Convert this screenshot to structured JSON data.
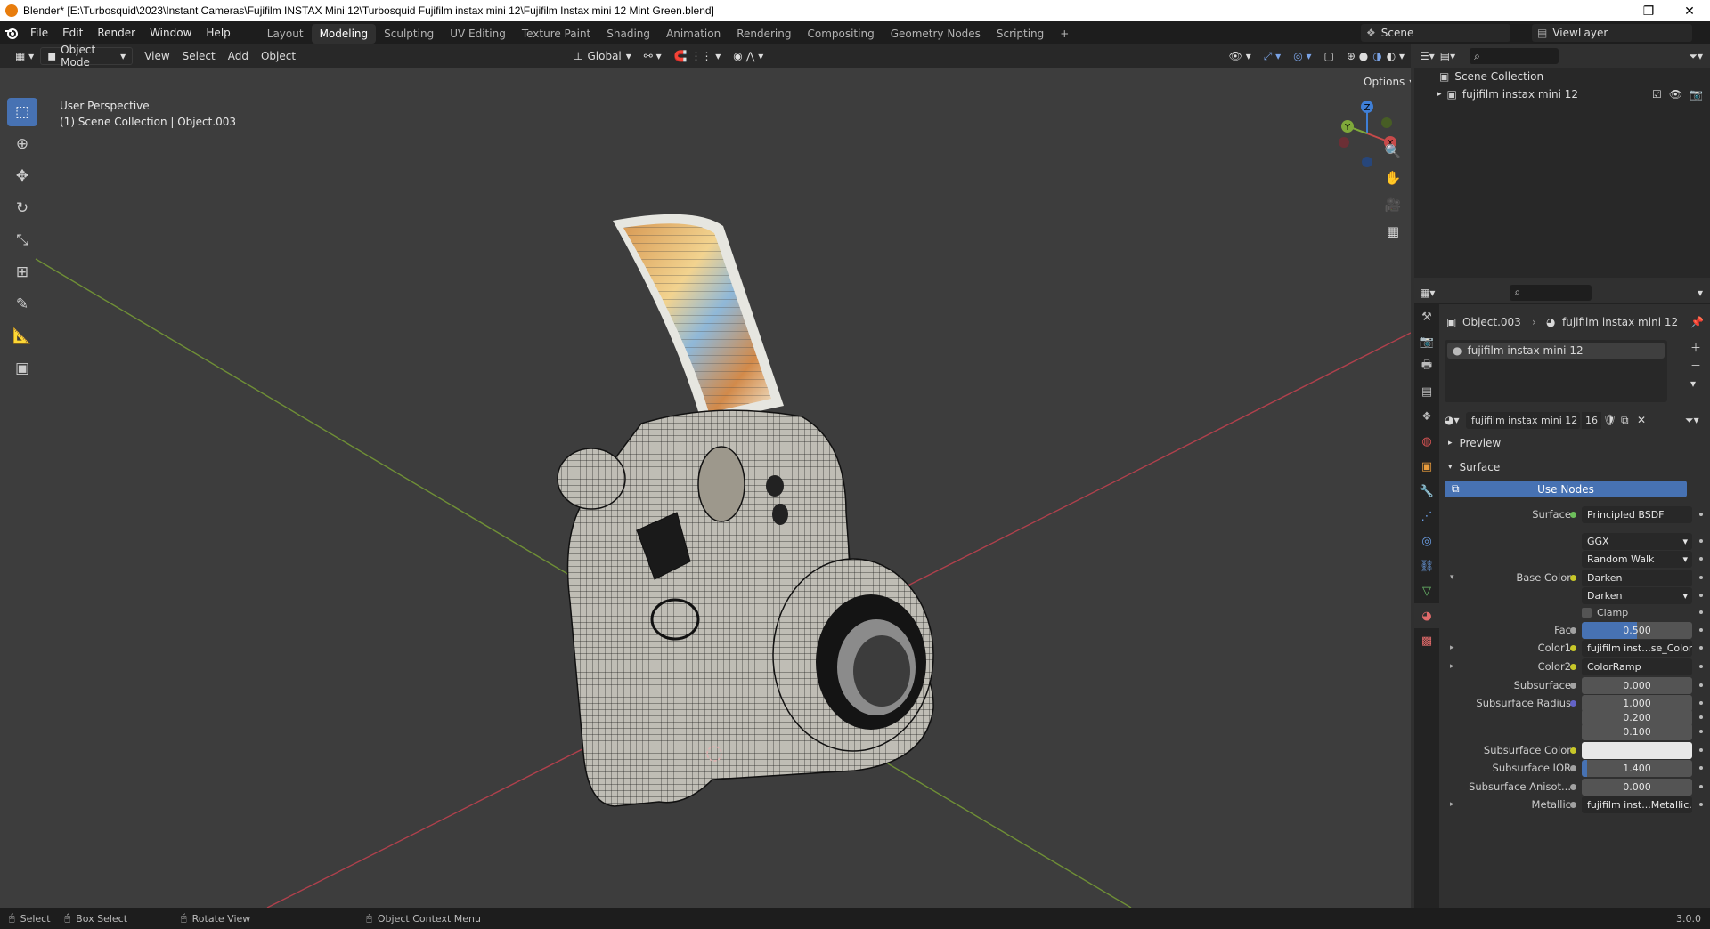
{
  "window": {
    "title": "Blender* [E:\\Turbosquid\\2023\\Instant Cameras\\Fujifilm INSTAX Mini 12\\Turbosquid Fujifilm instax mini 12\\Fujifilm Instax mini 12 Mint Green.blend]",
    "minimize": "–",
    "maximize": "❐",
    "close": "✕"
  },
  "topbar": {
    "menus": [
      "File",
      "Edit",
      "Render",
      "Window",
      "Help"
    ],
    "workspaces": [
      "Layout",
      "Modeling",
      "Sculpting",
      "UV Editing",
      "Texture Paint",
      "Shading",
      "Animation",
      "Rendering",
      "Compositing",
      "Geometry Nodes",
      "Scripting"
    ],
    "active_workspace": "Modeling",
    "add_tab": "+",
    "scene": "Scene",
    "view_layer": "ViewLayer"
  },
  "viewport_header": {
    "mode": "Object Mode",
    "menus": [
      "View",
      "Select",
      "Add",
      "Object"
    ],
    "orientation": "Global",
    "options": "Options"
  },
  "viewport": {
    "info_line1": "User Perspective",
    "info_line2": "(1) Scene Collection | Object.003",
    "gizmo": {
      "x": "X",
      "y": "Y",
      "z": "Z"
    }
  },
  "toolbar": {
    "tools": [
      "select-box-tool",
      "cursor-tool",
      "move-tool",
      "rotate-tool",
      "scale-tool",
      "transform-tool",
      "annotate-tool",
      "measure-tool",
      "add-cube-tool"
    ]
  },
  "outliner": {
    "root": "Scene Collection",
    "items": [
      {
        "label": "fujifilm instax mini 12"
      }
    ]
  },
  "properties": {
    "breadcrumb_object": "Object.003",
    "breadcrumb_material": "fujifilm instax mini 12",
    "material_slot": "fujifilm instax mini 12",
    "material_name": "fujifilm instax mini 12",
    "users": "16",
    "preview_label": "Preview",
    "surface_label": "Surface",
    "use_nodes": "Use Nodes",
    "rows": [
      {
        "label": "Surface",
        "value": "Principled BSDF",
        "socket": "#6dbf5b"
      },
      {
        "label": "",
        "value": "GGX",
        "dropdown": true
      },
      {
        "label": "",
        "value": "Random Walk",
        "dropdown": true
      },
      {
        "label": "Base Color",
        "value": "Darken",
        "socket": "#c7c729",
        "expand": "▾"
      },
      {
        "label": "",
        "value": "Darken",
        "dropdown": true
      },
      {
        "label": "",
        "value": "Clamp",
        "checkbox": true
      },
      {
        "label": "Fac",
        "value": "0.500",
        "socket": "#a1a1a1",
        "fill": 0.5
      },
      {
        "label": "Color1",
        "value": "fujifilm inst...se_Color.pn",
        "socket": "#c7c729",
        "expand": "▸"
      },
      {
        "label": "Color2",
        "value": "ColorRamp",
        "socket": "#c7c729",
        "expand": "▸"
      },
      {
        "label": "Subsurface",
        "value": "0.000",
        "socket": "#a1a1a1"
      },
      {
        "label": "Subsurface Radius",
        "value": "1.000",
        "socket": "#6363c7"
      },
      {
        "label": "",
        "value": "0.200"
      },
      {
        "label": "",
        "value": "0.100"
      },
      {
        "label": "Subsurface Color",
        "value": "",
        "socket": "#c7c729",
        "swatch": "#e8e8e8"
      },
      {
        "label": "Subsurface IOR",
        "value": "1.400",
        "socket": "#a1a1a1",
        "fill": 0.05
      },
      {
        "label": "Subsurface Anisot...",
        "value": "0.000",
        "socket": "#a1a1a1"
      },
      {
        "label": "Metallic",
        "value": "fujifilm inst...Metallic.png",
        "socket": "#a1a1a1",
        "expand": "▸"
      }
    ]
  },
  "statusbar": {
    "select": "Select",
    "box_select": "Box Select",
    "rotate_view": "Rotate View",
    "context_menu": "Object Context Menu",
    "version": "3.0.0"
  },
  "colors": {
    "accent": "#4772b3",
    "x_axis": "#c74a4a",
    "y_axis": "#7fa83a",
    "z_axis": "#3f7fd6"
  }
}
